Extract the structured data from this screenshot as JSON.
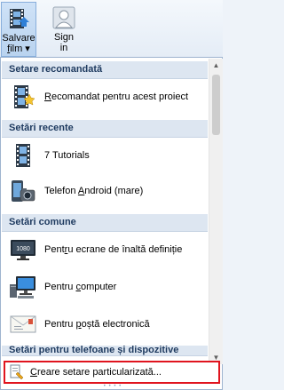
{
  "ribbon": {
    "save_movie": {
      "line1": "Salvare",
      "line2_pre": "",
      "line2_u": "f",
      "line2_post": "ilm ▾",
      "icon": "film-save-icon"
    },
    "sign_in": {
      "line1": "Sign",
      "line2": "in",
      "icon": "user-icon"
    }
  },
  "menu": {
    "sections": {
      "recommended": "Setare recomandată",
      "recent": "Setări recente",
      "common": "Setări comune",
      "phones": "Setări pentru telefoane și dispozitive"
    },
    "items": {
      "recommended_project": {
        "pre": "",
        "u": "R",
        "post": "ecomandat pentru acest proiect",
        "icon": "film-sparkle-icon"
      },
      "tutorials": {
        "pre": "7 Tutorials",
        "u": "",
        "post": "",
        "icon": "film-icon"
      },
      "android": {
        "pre": "Telefon ",
        "u": "A",
        "post": "ndroid (mare)",
        "icon": "phone-camera-icon"
      },
      "hd": {
        "pre": "Pent",
        "u": "r",
        "post": "u ecrane de înaltă definiție",
        "icon": "hd-screen-icon"
      },
      "computer": {
        "pre": "Pentru ",
        "u": "c",
        "post": "omputer",
        "icon": "computer-icon"
      },
      "email": {
        "pre": "Pentru ",
        "u": "p",
        "post": "oștă electronică",
        "icon": "email-icon"
      }
    },
    "custom": {
      "pre": "",
      "u": "C",
      "post": "reare setare particularizată...",
      "icon": "custom-setting-icon"
    },
    "grip": "• • • •"
  },
  "colors": {
    "highlight_border": "#e0141e",
    "header_bg": "#dde6f1",
    "header_text": "#1e3a5f"
  }
}
